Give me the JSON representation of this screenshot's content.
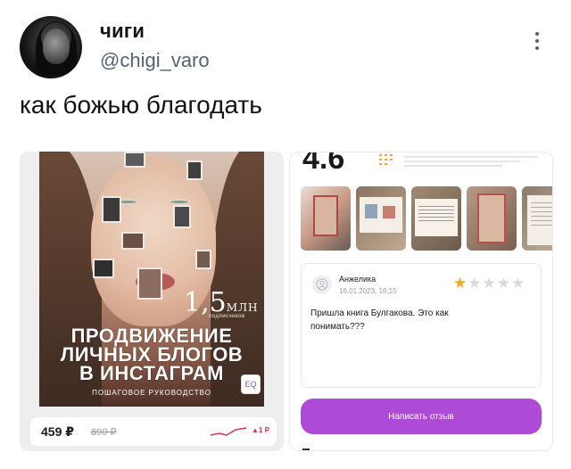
{
  "tweet": {
    "display_name": "чиги",
    "handle": "@chigi_varo",
    "text": "как божью благодать"
  },
  "book_card": {
    "cover": {
      "big_number": "1,5",
      "big_unit": "МЛН",
      "subscribers": "подписчиков",
      "title_line1": "ПРОДВИЖЕНИЕ",
      "title_line2": "ЛИЧНЫХ БЛОГОВ",
      "title_line3": "В ИНСТАГРАМ",
      "subtitle": "ПОШАГОВОЕ РУКОВОДСТВО",
      "quote_button": "EQ"
    },
    "price": "459 ₽",
    "old_price": "890 ₽",
    "trend": "▲1 Р",
    "colors": {
      "trend": "#e0334b"
    }
  },
  "review_screen": {
    "rating": "4.6",
    "review": {
      "author": "Анжелика",
      "date": "16.01.2023, 16:15",
      "stars": 1,
      "stars_total": 5,
      "text": "Пришла книга Булгакова. Это как понимать???"
    },
    "write_button": "Написать отзыв",
    "colors": {
      "accent": "#ad4ad8",
      "star": "#f5a623"
    }
  }
}
